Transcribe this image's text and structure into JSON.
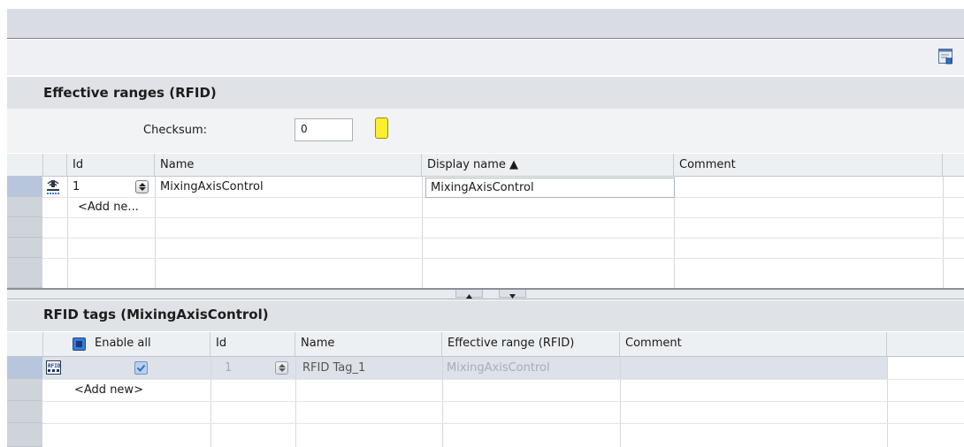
{
  "effective_ranges": {
    "title": "Effective ranges (RFID)",
    "checksum_label": "Checksum:",
    "checksum_value": "0",
    "columns": {
      "id": "Id",
      "name": "Name",
      "display_name": "Display name ▲",
      "comment": "Comment"
    },
    "rows": [
      {
        "id": "1",
        "name": "MixingAxisControl",
        "display_name": "MixingAxisControl",
        "comment": ""
      }
    ],
    "add_new": "<Add ne..."
  },
  "rfid_tags": {
    "title": "RFID tags (MixingAxisControl)",
    "columns": {
      "enable_all": "Enable all",
      "id": "Id",
      "name": "Name",
      "effective_range": "Effective range (RFID)",
      "comment": "Comment"
    },
    "rows": [
      {
        "enabled": true,
        "id": "1",
        "name": "RFID Tag_1",
        "effective_range": "MixingAxisControl",
        "comment": ""
      }
    ],
    "add_new": "<Add new>"
  },
  "icons": [
    "toolbar-edit-icon",
    "rfid-range-icon",
    "rfid-tag-icon",
    "spinner-icon",
    "led-indicator-icon"
  ]
}
